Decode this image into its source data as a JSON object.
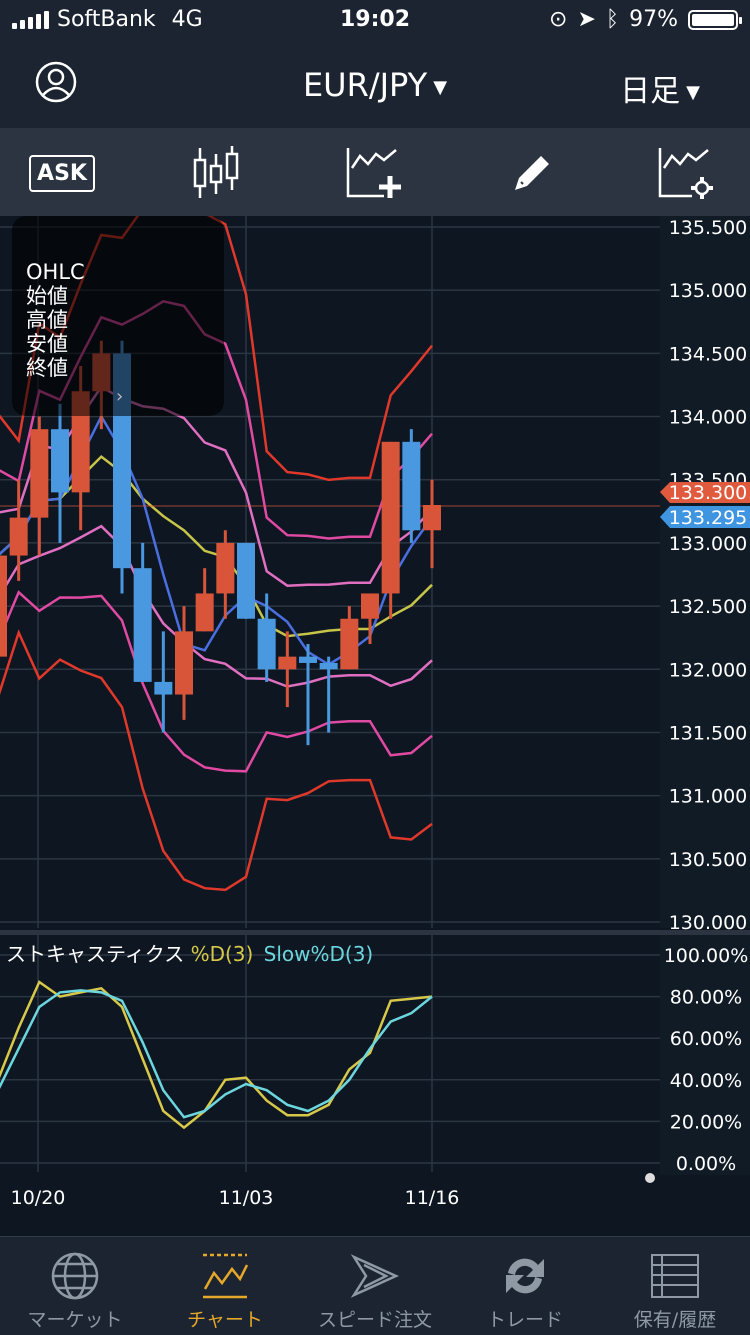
{
  "status": {
    "carrier": "SoftBank",
    "network": "4G",
    "time": "19:02",
    "battery": "97%"
  },
  "nav": {
    "pair": "EUR/JPY",
    "period": "日足"
  },
  "toolbar": {
    "ask_label": "ASK"
  },
  "ohlc": {
    "title": "OHLC",
    "open": "始値",
    "high": "高値",
    "low": "安値",
    "close": "終値"
  },
  "price_axis": [
    "135.500",
    "135.000",
    "134.500",
    "134.000",
    "133.500",
    "133.000",
    "132.500",
    "132.000",
    "131.500",
    "131.000",
    "130.500",
    "130.000"
  ],
  "bid_label": "133.300",
  "ask_price_label": "133.295",
  "stoch": {
    "name": "ストキャスティクス",
    "d_label": "%D(3)",
    "slowd_label": "Slow%D(3)",
    "axis": [
      "100.00%",
      "80.00%",
      "60.00%",
      "40.00%",
      "20.00%",
      "0.00%"
    ]
  },
  "dates": [
    "10/20",
    "11/03",
    "11/16"
  ],
  "tabs": [
    {
      "label": "マーケット"
    },
    {
      "label": "チャート"
    },
    {
      "label": "スピード注文"
    },
    {
      "label": "トレード"
    },
    {
      "label": "保有/履歴"
    }
  ],
  "colors": {
    "up": "#d9553a",
    "down": "#4a98e0",
    "bb3": "#e0392b",
    "bb2": "#e04aa3",
    "bb1": "#e06fc2",
    "ma": "#c7c44a",
    "ma2": "#4a6fe0",
    "d": "#d8c84a",
    "slowd": "#6cd6de",
    "active": "#e6a82a"
  },
  "chart_data": {
    "type": "candlestick",
    "candles": [
      {
        "open": 132.1,
        "high": 133.0,
        "low": 132.0,
        "close": 132.9
      },
      {
        "open": 132.9,
        "high": 133.5,
        "low": 132.7,
        "close": 133.2
      },
      {
        "open": 133.2,
        "high": 134.0,
        "low": 132.9,
        "close": 133.9
      },
      {
        "open": 133.9,
        "high": 134.1,
        "low": 133.0,
        "close": 133.4
      },
      {
        "open": 133.4,
        "high": 134.4,
        "low": 133.1,
        "close": 134.2
      },
      {
        "open": 134.2,
        "high": 134.6,
        "low": 133.9,
        "close": 134.5
      },
      {
        "open": 134.5,
        "high": 134.6,
        "low": 132.6,
        "close": 132.8
      },
      {
        "open": 132.8,
        "high": 133.0,
        "low": 131.9,
        "close": 131.9
      },
      {
        "open": 131.9,
        "high": 132.3,
        "low": 131.5,
        "close": 131.8
      },
      {
        "open": 131.8,
        "high": 132.5,
        "low": 131.6,
        "close": 132.3
      },
      {
        "open": 132.3,
        "high": 132.8,
        "low": 132.3,
        "close": 132.6
      },
      {
        "open": 132.6,
        "high": 133.1,
        "low": 132.4,
        "close": 133.0
      },
      {
        "open": 133.0,
        "high": 133.0,
        "low": 132.4,
        "close": 132.4
      },
      {
        "open": 132.4,
        "high": 132.6,
        "low": 131.9,
        "close": 132.0
      },
      {
        "open": 132.0,
        "high": 132.3,
        "low": 131.7,
        "close": 132.1
      },
      {
        "open": 132.1,
        "high": 132.2,
        "low": 131.4,
        "close": 132.05
      },
      {
        "open": 132.05,
        "high": 132.1,
        "low": 131.5,
        "close": 132.0
      },
      {
        "open": 132.0,
        "high": 132.5,
        "low": 132.0,
        "close": 132.4
      },
      {
        "open": 132.4,
        "high": 132.6,
        "low": 132.2,
        "close": 132.6
      },
      {
        "open": 132.6,
        "high": 133.8,
        "low": 132.4,
        "close": 133.8
      },
      {
        "open": 133.8,
        "high": 133.9,
        "low": 133.0,
        "close": 133.1
      },
      {
        "open": 133.1,
        "high": 133.5,
        "low": 132.8,
        "close": 133.3
      }
    ],
    "stoch_d": [
      40,
      65,
      87,
      80,
      82,
      84,
      75,
      50,
      25,
      17,
      25,
      40,
      41,
      30,
      23,
      23,
      28,
      45,
      53,
      78,
      79,
      80
    ],
    "stoch_slowd": [
      35,
      55,
      75,
      82,
      83,
      82,
      78,
      58,
      35,
      22,
      25,
      33,
      38,
      35,
      28,
      25,
      30,
      40,
      55,
      68,
      72,
      80
    ]
  }
}
